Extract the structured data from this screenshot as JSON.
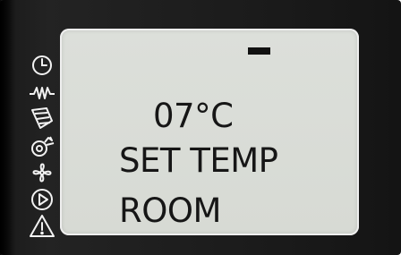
{
  "display": {
    "segment_indicator": "-",
    "temperature": "07°C",
    "line2": "SET TEMP",
    "line3": "ROOM"
  },
  "icons": [
    "clock-icon",
    "waveform-icon",
    "defrost-icon",
    "compressor-icon",
    "fan-icon",
    "play-icon",
    "alarm-warning-icon"
  ],
  "colors": {
    "bezel": "#1c1c1c",
    "lcd_background": "#d8dbd5",
    "lcd_text": "#161616",
    "icon": "#f2f2f2"
  }
}
